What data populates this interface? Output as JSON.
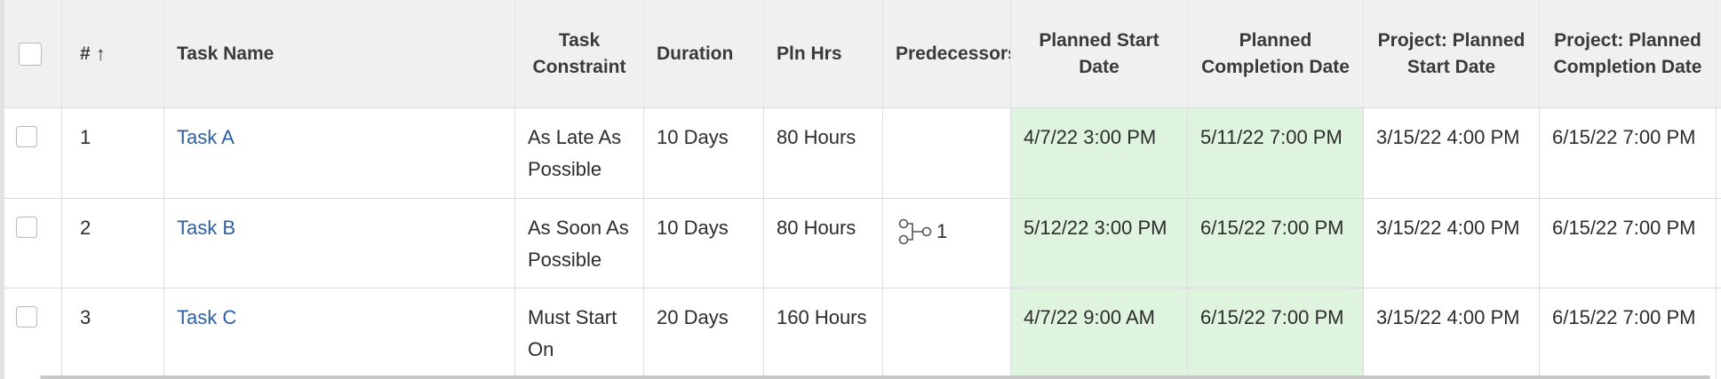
{
  "table": {
    "columns": [
      {
        "label": ""
      },
      {
        "label": "#"
      },
      {
        "label": "Task Name"
      },
      {
        "label": "Task Constraint"
      },
      {
        "label": "Duration"
      },
      {
        "label": "Pln Hrs"
      },
      {
        "label": "Predecessors"
      },
      {
        "label": "Planned Start Date"
      },
      {
        "label": "Planned Completion Date"
      },
      {
        "label": "Project: Planned Start Date"
      },
      {
        "label": "Project: Planned Completion Date"
      }
    ],
    "sort_arrow": "↑",
    "rows": [
      {
        "num": "1",
        "name": "Task A",
        "constraint": "As Late As Possible",
        "duration": "10 Days",
        "pln_hrs": "80 Hours",
        "predecessors": "",
        "planned_start": "4/7/22 3:00 PM",
        "planned_completion": "5/11/22 7:00 PM",
        "project_start": "3/15/22 4:00 PM",
        "project_completion": "6/15/22 7:00 PM"
      },
      {
        "num": "2",
        "name": "Task B",
        "constraint": "As Soon As Possible",
        "duration": "10 Days",
        "pln_hrs": "80 Hours",
        "predecessors": "1",
        "planned_start": "5/12/22 3:00 PM",
        "planned_completion": "6/15/22 7:00 PM",
        "project_start": "3/15/22 4:00 PM",
        "project_completion": "6/15/22 7:00 PM"
      },
      {
        "num": "3",
        "name": "Task C",
        "constraint": "Must Start On",
        "duration": "20 Days",
        "pln_hrs": "160 Hours",
        "predecessors": "",
        "planned_start": "4/7/22 9:00 AM",
        "planned_completion": "6/15/22 7:00 PM",
        "project_start": "3/15/22 4:00 PM",
        "project_completion": "6/15/22 7:00 PM"
      }
    ]
  },
  "colors": {
    "highlight": "#dff4df",
    "link": "#2b5ea6",
    "header_bg": "#f0f0f0"
  },
  "icons": {
    "predecessor": "predecessor-link-icon"
  }
}
